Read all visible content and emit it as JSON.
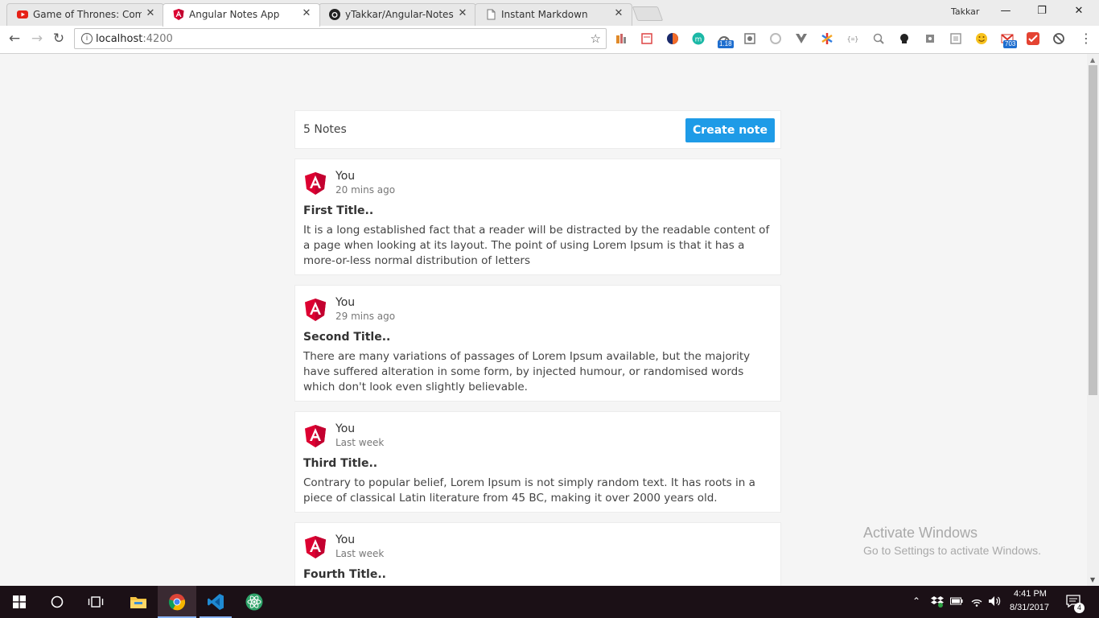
{
  "browser": {
    "tabs": [
      {
        "label": "Game of Thrones: Compl",
        "icon": "youtube-icon"
      },
      {
        "label": "Angular Notes App",
        "icon": "angular-icon"
      },
      {
        "label": "yTakkar/Angular-Notes-A",
        "icon": "github-icon"
      },
      {
        "label": "Instant Markdown",
        "icon": "page-icon"
      }
    ],
    "close_glyph": "✕",
    "profile_name": "Takkar",
    "window_controls": {
      "minimize": "—",
      "maximize": "❐",
      "close": "✕"
    },
    "url_host": "localhost",
    "url_port": ":4200",
    "extension_badges": {
      "speed": "1.18",
      "mail": "703"
    }
  },
  "header": {
    "notes_count": "5 Notes",
    "create_label": "Create note"
  },
  "notes": [
    {
      "author": "You",
      "time": "20 mins ago",
      "title": "First Title..",
      "body": "It is a long established fact that a reader will be distracted by the readable content of a page when looking at its layout. The point of using Lorem Ipsum is that it has a more-or-less normal distribution of letters"
    },
    {
      "author": "You",
      "time": "29 mins ago",
      "title": "Second Title..",
      "body": "There are many variations of passages of Lorem Ipsum available, but the majority have suffered alteration in some form, by injected humour, or randomised words which don't look even slightly believable."
    },
    {
      "author": "You",
      "time": "Last week",
      "title": "Third Title..",
      "body": "Contrary to popular belief, Lorem Ipsum is not simply random text. It has roots in a piece of classical Latin literature from 45 BC, making it over 2000 years old."
    },
    {
      "author": "You",
      "time": "Last week",
      "title": "Fourth Title.."
    }
  ],
  "watermark": {
    "line1": "Activate Windows",
    "line2": "Go to Settings to activate Windows."
  },
  "taskbar": {
    "time": "4:41 PM",
    "date": "8/31/2017",
    "notification_count": "4"
  },
  "colors": {
    "accent": "#1e9be7",
    "angular_red": "#dd0031",
    "taskbar": "#1b1016"
  }
}
